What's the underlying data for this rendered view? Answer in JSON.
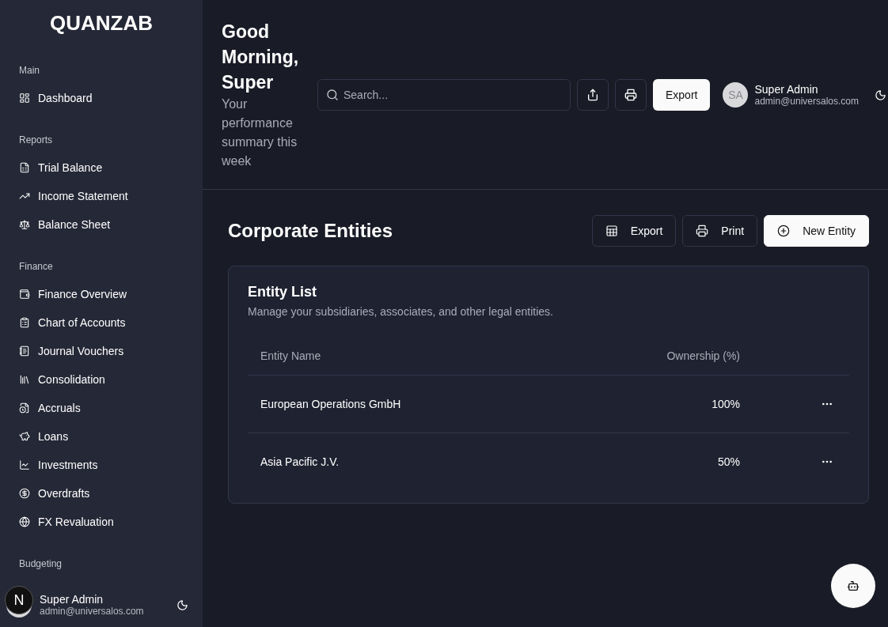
{
  "sidebar": {
    "logo": "QUANZAB",
    "sections": [
      {
        "title": "Main",
        "items": [
          {
            "label": "Dashboard"
          }
        ]
      },
      {
        "title": "Reports",
        "items": [
          {
            "label": "Trial Balance"
          },
          {
            "label": "Income Statement"
          },
          {
            "label": "Balance Sheet"
          }
        ]
      },
      {
        "title": "Finance",
        "items": [
          {
            "label": "Finance Overview"
          },
          {
            "label": "Chart of Accounts"
          },
          {
            "label": "Journal Vouchers"
          },
          {
            "label": "Consolidation"
          },
          {
            "label": "Accruals"
          },
          {
            "label": "Loans"
          },
          {
            "label": "Investments"
          },
          {
            "label": "Overdrafts"
          },
          {
            "label": "FX Revaluation"
          }
        ]
      },
      {
        "title": "Budgeting"
      }
    ],
    "user": {
      "name": "Super Admin",
      "email": "admin@universalos.com"
    },
    "badge": "N"
  },
  "header": {
    "greeting": "Good Morning, Super",
    "subtitle": "Your performance summary this week",
    "search": {
      "placeholder": "Search..."
    },
    "export_button": "Export",
    "user": {
      "initials": "SA",
      "name": "Super Admin",
      "email": "admin@universalos.com"
    }
  },
  "page": {
    "title": "Corporate Entities",
    "actions": [
      {
        "label": "Export",
        "primary": false
      },
      {
        "label": "Print",
        "primary": false
      },
      {
        "label": "New Entity",
        "primary": true
      }
    ],
    "card": {
      "title": "Entity List",
      "description": "Manage your subsidiaries, associates, and other legal entities.",
      "columns": [
        "Entity Name",
        "Ownership (%)"
      ],
      "rows": [
        {
          "name": "European Operations GmbH",
          "ownership": "100%"
        },
        {
          "name": "Asia Pacific J.V.",
          "ownership": "50%"
        }
      ]
    }
  }
}
